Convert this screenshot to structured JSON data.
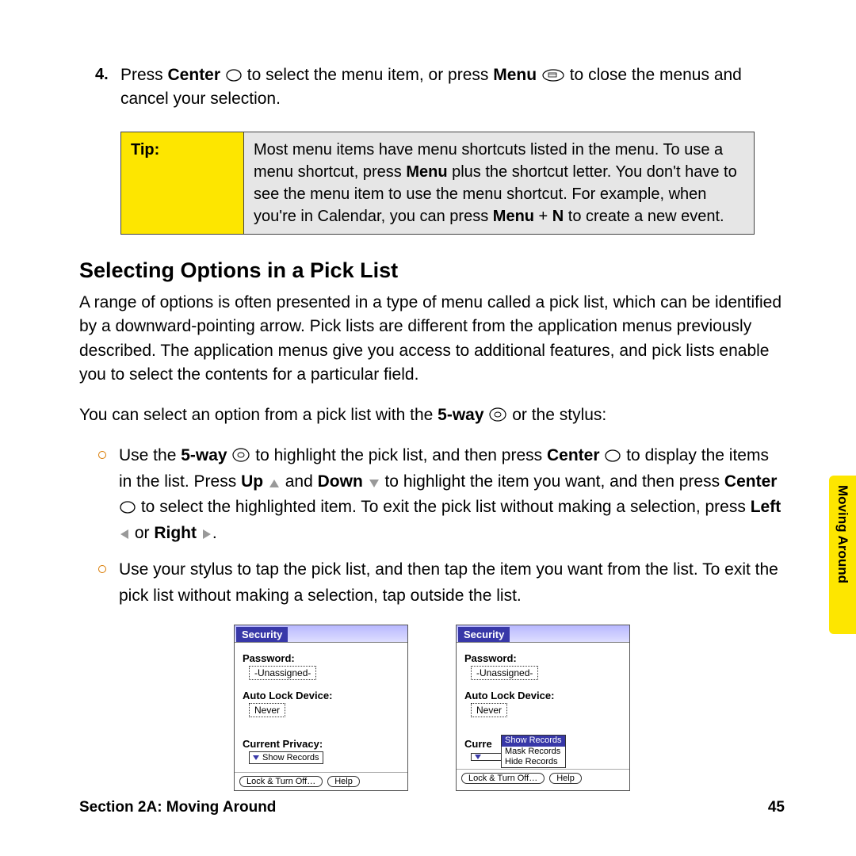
{
  "step4": {
    "number": "4.",
    "prefix": "Press ",
    "centerWord": "Center",
    "mid1": " to select the menu item, or press ",
    "menuWord": "Menu",
    "mid2": " to close the menus and cancel your selection."
  },
  "tip": {
    "label": "Tip:",
    "body_pre": "Most menu items have menu shortcuts listed in the menu. To use a menu shortcut, press ",
    "body_b1": "Menu",
    "body_mid": " plus the shortcut letter. You don't have to see the menu item to use the menu shortcut. For example, when you're in Calendar, you can press ",
    "body_b2": "Menu",
    "body_plus": " + ",
    "body_b3": "N",
    "body_post": " to create a new event."
  },
  "heading": "Selecting Options in a Pick List",
  "para1": "A range of options is often presented in a type of menu called a pick list, which can be identified by a downward-pointing arrow. Pick lists are different from the application menus previously described. The application menus give you access to additional features, and pick lists enable you to select the contents for a particular field.",
  "para2_pre": "You can select an option from a pick list with the ",
  "para2_b1": "5-way",
  "para2_post": " or the stylus:",
  "bullet1": {
    "p1": "Use the ",
    "b1": "5-way",
    "p2": " to highlight the pick list, and then press ",
    "b2": "Center",
    "p3": " to display the items in the list. Press ",
    "b3": "Up",
    "p4": " and ",
    "b4": "Down",
    "p5": " to highlight the item you want, and then press ",
    "b5": "Center",
    "p6": " to select the highlighted item. To exit the pick list without making a selection, press ",
    "b6": "Left",
    "p7": " or ",
    "b7": "Right",
    "p8": "."
  },
  "bullet2": "Use your stylus to tap the pick list, and then tap the item you want from the list. To exit the pick list without making a selection, tap outside the list.",
  "screen": {
    "title": "Security",
    "passwordLabel": "Password:",
    "passwordValue": "-Unassigned-",
    "autolockLabel": "Auto Lock Device:",
    "autolockValue": "Never",
    "privacyLabel": "Current Privacy:",
    "privacyLabelCut": "Curre",
    "privacyValue": "Show Records",
    "btnLock": "Lock & Turn Off…",
    "btnHelp": "Help",
    "popup": [
      "Show Records",
      "Mask Records",
      "Hide Records"
    ]
  },
  "footer": {
    "left": "Section 2A: Moving Around",
    "right": "45"
  },
  "sideTab": "Moving Around"
}
